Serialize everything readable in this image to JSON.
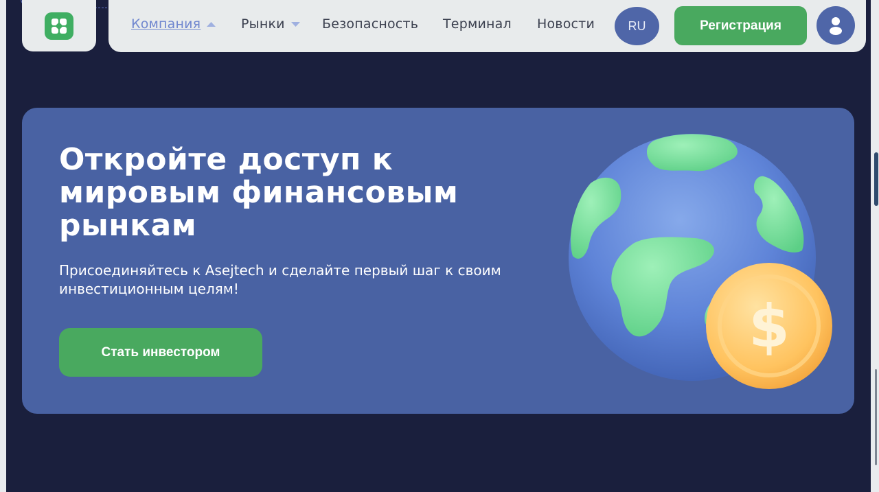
{
  "nav": {
    "items": [
      {
        "label": "Компания",
        "active": true,
        "has_dropdown": true
      },
      {
        "label": "Рынки",
        "active": false,
        "has_dropdown": true
      },
      {
        "label": "Безопасность",
        "active": false,
        "has_dropdown": false
      },
      {
        "label": "Терминал",
        "active": false,
        "has_dropdown": false
      },
      {
        "label": "Новости",
        "active": false,
        "has_dropdown": false
      }
    ],
    "language": "RU",
    "register_label": "Регистрация",
    "logo_icon": "clover-logo-icon",
    "avatar_icon": "user-icon"
  },
  "hero": {
    "title": "Откройте доступ к мировым финансовым рынкам",
    "subtitle": "Присоединяйтесь к Asejtech и сделайте первый шаг к своим инвестиционным целям!",
    "cta_label": "Стать инвестором",
    "illustration_icon": "globe-with-dollar-coin-icon"
  },
  "colors": {
    "page_bg": "#1a1f3d",
    "nav_bg": "#e8ebec",
    "accent_green": "#49a95f",
    "accent_blue": "#4f66a8",
    "hero_bg": "#4962a3"
  }
}
